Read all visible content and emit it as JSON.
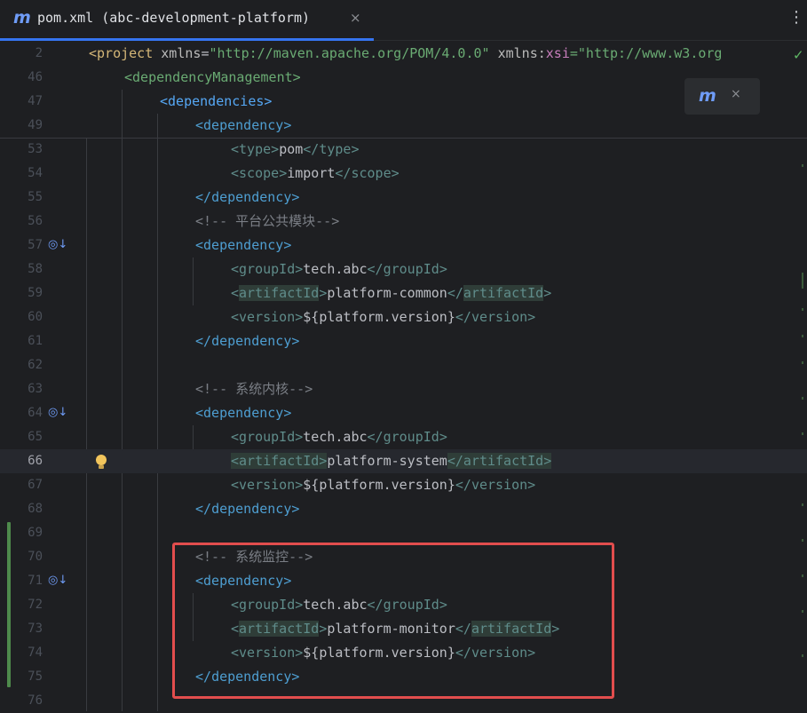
{
  "tab": {
    "title": "pom.xml (abc-development-platform)",
    "icon": "m",
    "close": "×",
    "more": "⋮"
  },
  "floater": {
    "icon": "m",
    "close": "×"
  },
  "lines": [
    {
      "num": "2"
    },
    {
      "num": "46"
    },
    {
      "num": "47"
    },
    {
      "num": "49"
    },
    {
      "num": "53"
    },
    {
      "num": "54"
    },
    {
      "num": "55"
    },
    {
      "num": "56"
    },
    {
      "num": "57"
    },
    {
      "num": "58"
    },
    {
      "num": "59"
    },
    {
      "num": "60"
    },
    {
      "num": "61"
    },
    {
      "num": "62"
    },
    {
      "num": "63"
    },
    {
      "num": "64"
    },
    {
      "num": "65"
    },
    {
      "num": "66"
    },
    {
      "num": "67"
    },
    {
      "num": "68"
    },
    {
      "num": "69"
    },
    {
      "num": "70"
    },
    {
      "num": "71"
    },
    {
      "num": "72"
    },
    {
      "num": "73"
    },
    {
      "num": "74"
    },
    {
      "num": "75"
    },
    {
      "num": "76"
    }
  ],
  "code": {
    "l2": {
      "project": "project",
      "xmlns": "xmlns",
      "xmlns_val": "\"http://maven.apache.org/POM/4.0.0\"",
      "xmlns2": "xmlns:",
      "xsi": "xsi",
      "xsi_val": "=\"http://www.w3.org"
    },
    "l46": "dependencyManagement",
    "l47": "dependencies",
    "l49": "dependency",
    "l53": {
      "tag": "type",
      "val": "pom"
    },
    "l54": {
      "tag": "scope",
      "val": "import"
    },
    "l55": "dependency",
    "l56": "<!-- 平台公共模块-->",
    "l57": "dependency",
    "l58": {
      "tag": "groupId",
      "val": "tech.abc"
    },
    "l59": {
      "tag": "artifactId",
      "val": "platform-common"
    },
    "l60": {
      "tag": "version",
      "val": "${platform.version}"
    },
    "l61": "dependency",
    "l63": "<!-- 系统内核-->",
    "l64": "dependency",
    "l65": {
      "tag": "groupId",
      "val": "tech.abc"
    },
    "l66": {
      "tag": "artifactId",
      "val": "platform-system"
    },
    "l67": {
      "tag": "version",
      "val": "${platform.version}"
    },
    "l68": "dependency",
    "l70": "<!-- 系统监控-->",
    "l71": "dependency",
    "l72": {
      "tag": "groupId",
      "val": "tech.abc"
    },
    "l73": {
      "tag": "artifactId",
      "val": "platform-monitor"
    },
    "l74": {
      "tag": "version",
      "val": "${platform.version}"
    },
    "l75": "dependency"
  }
}
